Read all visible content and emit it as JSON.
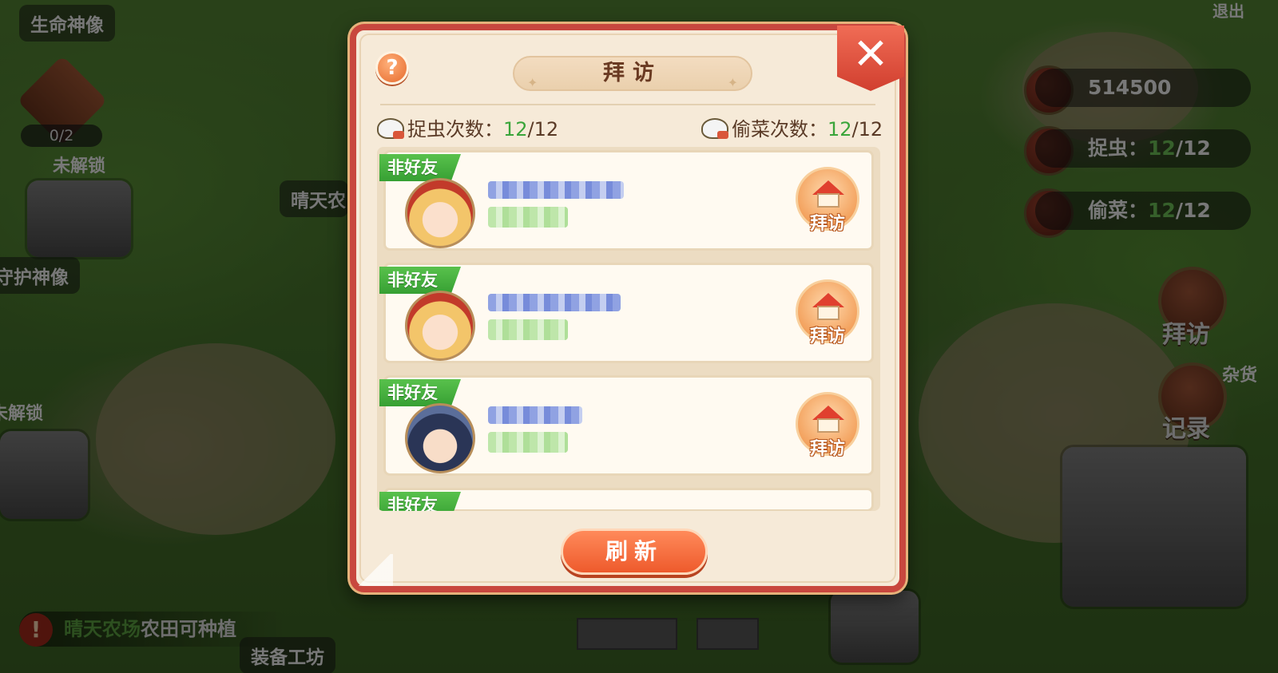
{
  "background": {
    "hud_labels": {
      "life_statue": "生命神像",
      "guard_statue": "守护神像",
      "locked_1": "未解锁",
      "locked_2": "未解锁",
      "sunny_farm_sign": "晴天农",
      "workshop": "装备工坊",
      "exit": "退出",
      "shop_partial": "杂货"
    },
    "emblem_counter": "0/2",
    "resources": {
      "coins": "514500",
      "catch_bugs_label": "捉虫：",
      "catch_bugs_value": "12",
      "catch_bugs_total": "/12",
      "steal_veg_label": "偷菜：",
      "steal_veg_value": "12",
      "steal_veg_total": "/12"
    },
    "side_buttons": {
      "visit": "拜访",
      "record": "记录"
    },
    "notice": {
      "highlight": "晴天农场",
      "text": "农田可种植",
      "icon": "!"
    }
  },
  "dialog": {
    "title": "拜访",
    "help_icon": "?",
    "close_icon": "✕",
    "stats": {
      "catch_label": "捉虫次数：",
      "catch_value": "12",
      "catch_total": "/12",
      "steal_label": "偷菜次数：",
      "steal_value": "12",
      "steal_total": "/12"
    },
    "cards": [
      {
        "tag": "非好友",
        "visit_label": "拜访"
      },
      {
        "tag": "非好友",
        "visit_label": "拜访"
      },
      {
        "tag": "非好友",
        "visit_label": "拜访"
      },
      {
        "tag": "非好友"
      }
    ],
    "refresh_label": "刷新"
  },
  "colors": {
    "dialog_border": "#c8473e",
    "tag_green": "#37a033",
    "value_green": "#3aa53a",
    "refresh_orange": "#ee5a2c"
  }
}
